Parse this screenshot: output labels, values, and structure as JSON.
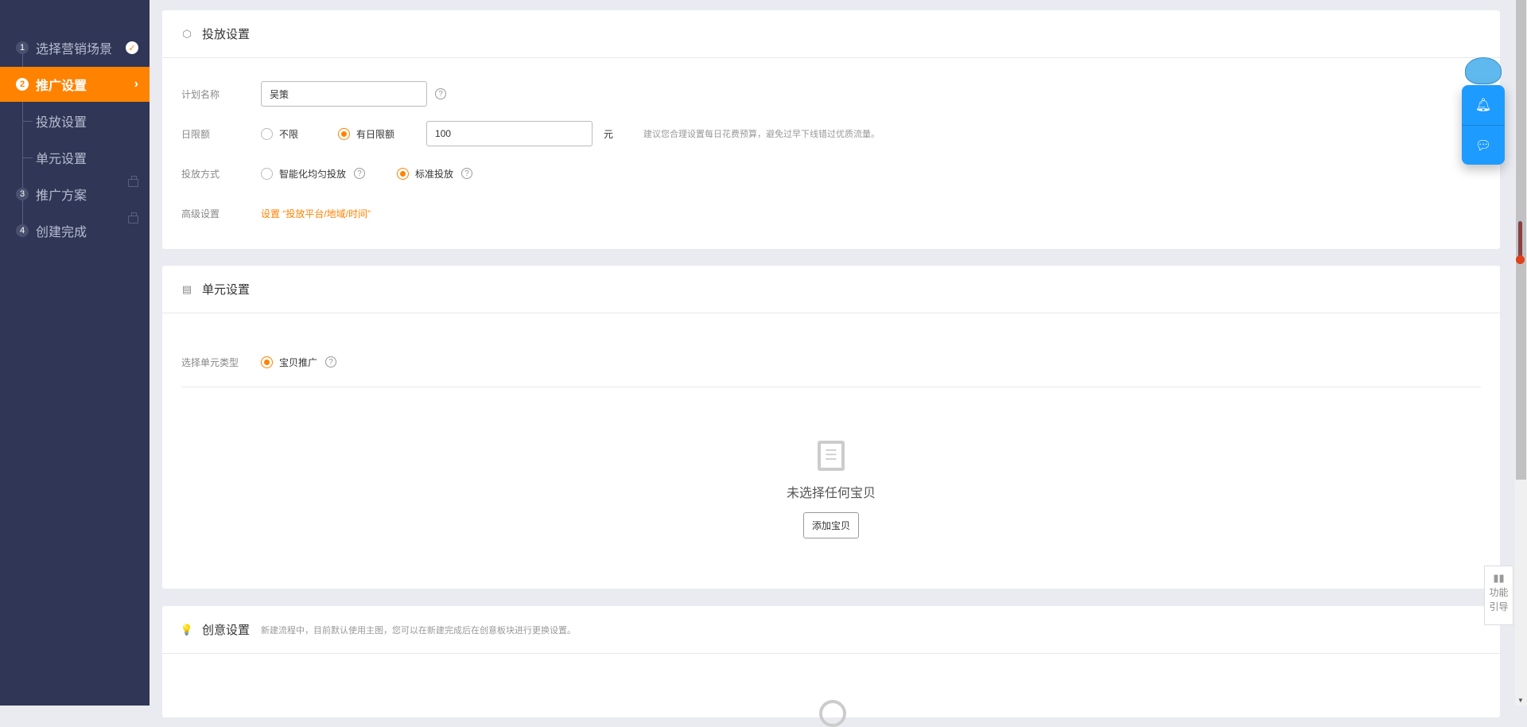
{
  "sidebar": {
    "steps": [
      {
        "num": "1",
        "label": "选择营销场景",
        "state": "done"
      },
      {
        "num": "2",
        "label": "推广设置",
        "state": "active"
      },
      {
        "label": "投放设置",
        "sub": true
      },
      {
        "label": "单元设置",
        "sub": true
      },
      {
        "num": "3",
        "label": "推广方案",
        "state": "locked"
      },
      {
        "num": "4",
        "label": "创建完成",
        "state": "locked"
      }
    ]
  },
  "placement": {
    "title": "投放设置",
    "plan_name_label": "计划名称",
    "plan_name_value": "吴策",
    "budget_label": "日限额",
    "budget_unlimited": "不限",
    "budget_limited": "有日限额",
    "budget_value": "100",
    "budget_unit": "元",
    "budget_hint": "建议您合理设置每日花费预算，避免过早下线错过优质流量。",
    "method_label": "投放方式",
    "method_smart": "智能化均匀投放",
    "method_standard": "标准投放",
    "advanced_label": "高级设置",
    "advanced_link": "设置 “投放平台/地域/时间”"
  },
  "unit": {
    "title": "单元设置",
    "type_label": "选择单元类型",
    "type_option": "宝贝推广",
    "empty_text": "未选择任何宝贝",
    "add_button": "添加宝贝"
  },
  "creative": {
    "title": "创意设置",
    "hint": "新建流程中，目前默认使用主图，您可以在新建完成后在创意板块进行更换设置。"
  },
  "guide": {
    "line1": "功能",
    "line2": "引导"
  },
  "colors": {
    "accent": "#ff8200",
    "sidebar": "#2f3656",
    "float": "#1e9bff"
  }
}
